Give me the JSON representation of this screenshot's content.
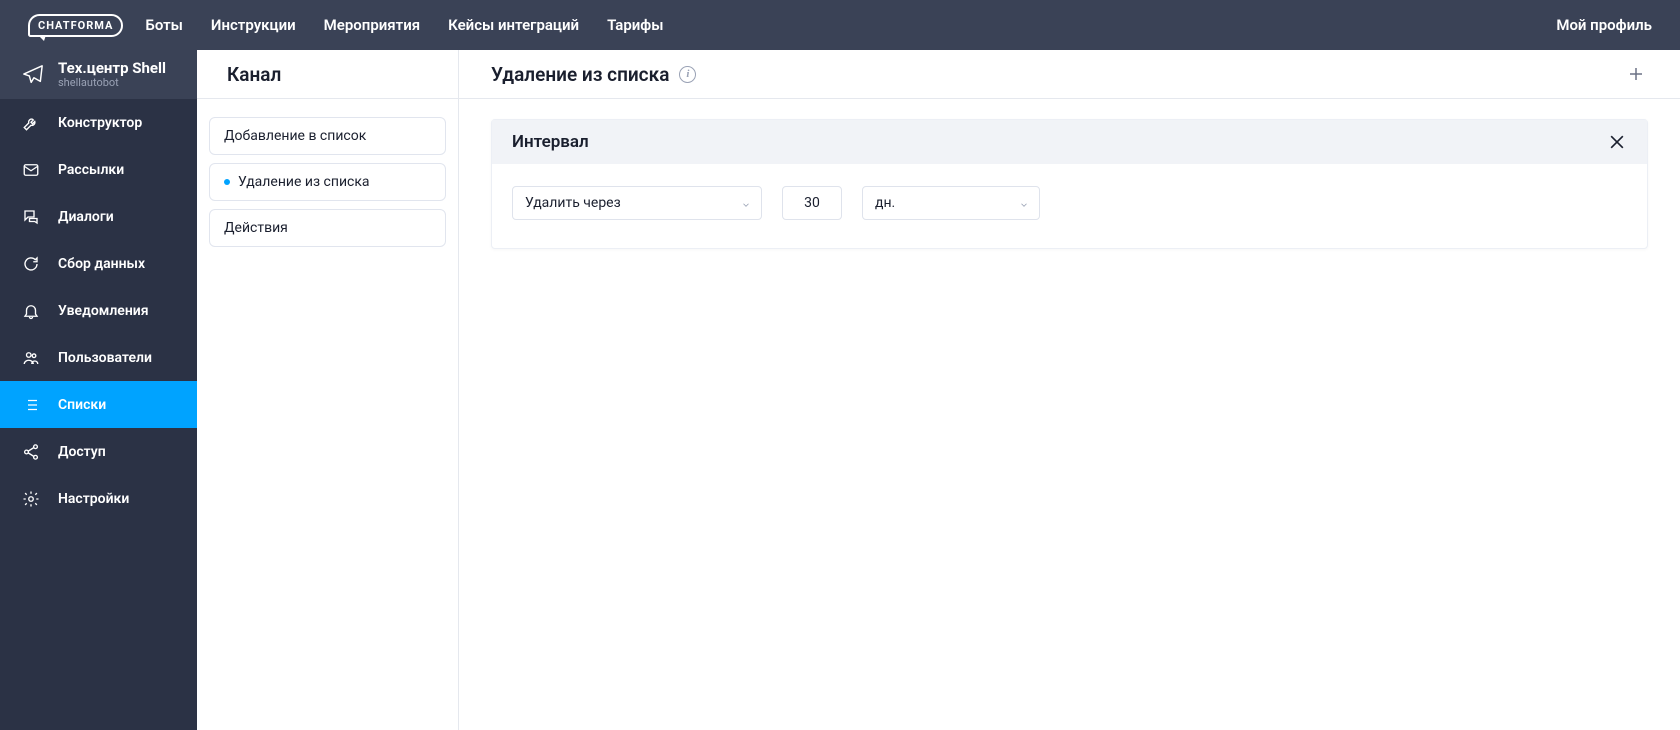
{
  "brand": "CHATFORMA",
  "topnav": {
    "items": [
      "Боты",
      "Инструкции",
      "Мероприятия",
      "Кейсы интеграций",
      "Тарифы"
    ],
    "profile": "Мой профиль"
  },
  "bot": {
    "title": "Тех.центр Shell",
    "sub": "shellautobot"
  },
  "sidebar": {
    "items": [
      {
        "label": "Конструктор"
      },
      {
        "label": "Рассылки"
      },
      {
        "label": "Диалоги"
      },
      {
        "label": "Сбор данных"
      },
      {
        "label": "Уведомления"
      },
      {
        "label": "Пользователи"
      },
      {
        "label": "Списки"
      },
      {
        "label": "Доступ"
      },
      {
        "label": "Настройки"
      }
    ],
    "active_index": 6
  },
  "kanal": {
    "title": "Канал",
    "items": [
      {
        "label": "Добавление в список",
        "active": false
      },
      {
        "label": "Удаление из списка",
        "active": true
      },
      {
        "label": "Действия",
        "active": false
      }
    ]
  },
  "main": {
    "title": "Удаление из списка",
    "card": {
      "title": "Интервал",
      "mode_select": {
        "value": "Удалить через"
      },
      "amount": "30",
      "unit_select": {
        "value": "дн."
      }
    }
  }
}
